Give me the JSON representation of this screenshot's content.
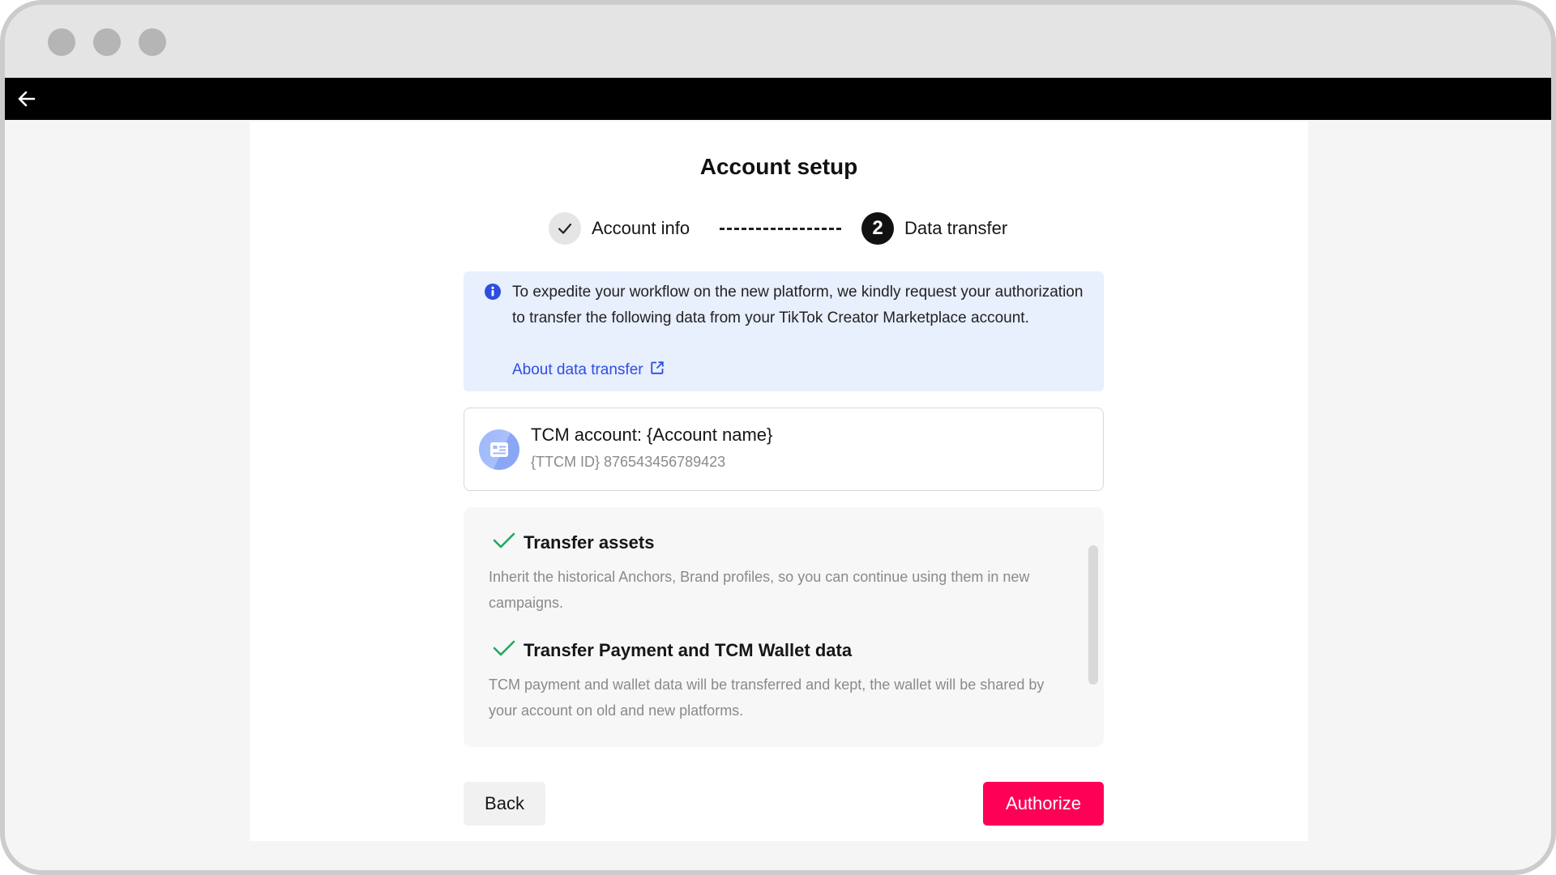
{
  "window": {
    "traffic_lights": [
      "close",
      "minimize",
      "maximize"
    ]
  },
  "topbar": {
    "back_icon": "arrow-left-icon"
  },
  "page": {
    "title": "Account setup"
  },
  "stepper": {
    "steps": [
      {
        "label": "Account info",
        "status": "done",
        "icon": "check-icon"
      },
      {
        "label": "Data transfer",
        "status": "active",
        "number": "2"
      }
    ]
  },
  "info_banner": {
    "icon": "info-icon",
    "text": "To expedite your workflow on the new platform, we kindly request your authorization to transfer the following data from your TikTok Creator Marketplace account.",
    "link_label": "About data transfer",
    "link_icon": "external-link-icon",
    "accent_color": "#2f4ee0",
    "background_color": "#e8effd"
  },
  "account_card": {
    "icon": "id-card-icon",
    "name": "TCM account: {Account name}",
    "id_line": "{TTCM ID} 876543456789423"
  },
  "benefits": [
    {
      "icon": "check-icon",
      "title": "Transfer assets",
      "description": "Inherit the historical Anchors, Brand profiles, so you can continue using them in new campaigns."
    },
    {
      "icon": "check-icon",
      "title": "Transfer Payment and TCM Wallet data",
      "description": "TCM payment and wallet data will be transferred and kept, the wallet will be shared by your account on old and new platforms."
    }
  ],
  "actions": {
    "back_label": "Back",
    "authorize_label": "Authorize",
    "authorize_color": "#fe0156"
  },
  "colors": {
    "check_green": "#1faa5b"
  }
}
